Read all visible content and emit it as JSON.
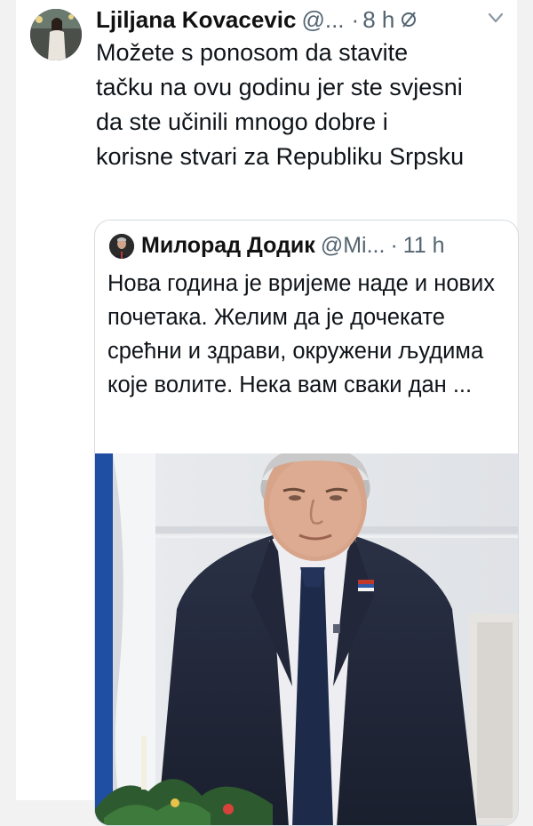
{
  "tweet": {
    "author_name": "Ljiljana Kovacevic",
    "author_handle": "@...",
    "separator": "·",
    "time": "8 h",
    "text": "Možete s ponosom da stavite tačku na ovu godinu jer ste svjesni da ste učinili mnogo dobre i korisne stvari za Republiku Srpsku",
    "icons": {
      "edited": "edit-pencil-icon",
      "more": "more-options-icon"
    }
  },
  "quoted_tweet": {
    "author_name": "Милорад Додик",
    "author_handle": "@Mi...",
    "separator": "·",
    "time": "11 h",
    "text": "Нова година је вријеме наде и нових почетака. Желим да је дочекате срећни и здрави, окружени људима које волите. Нека вам сваки дан ...",
    "media": "photo-of-man-in-suit"
  },
  "colors": {
    "background": "#f2f2f2",
    "card": "#ffffff",
    "text": "#0f1419",
    "secondary_text": "#536471",
    "border": "#d5dbe0"
  }
}
